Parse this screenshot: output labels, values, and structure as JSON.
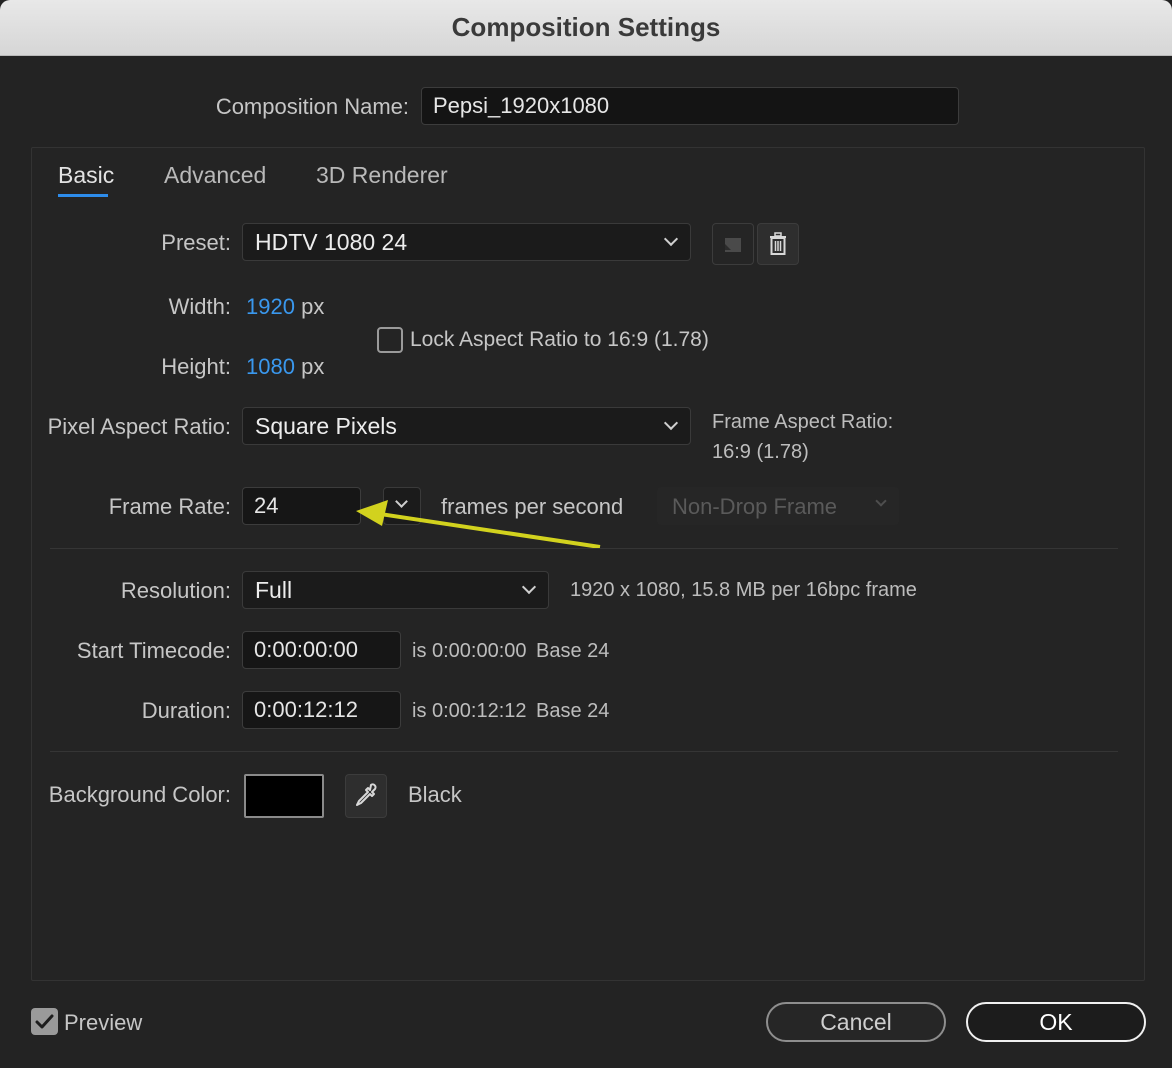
{
  "window": {
    "title": "Composition Settings"
  },
  "composition_name": {
    "label": "Composition Name:",
    "value": "Pepsi_1920x1080"
  },
  "tabs": [
    {
      "label": "Basic",
      "active": true
    },
    {
      "label": "Advanced",
      "active": false
    },
    {
      "label": "3D Renderer",
      "active": false
    }
  ],
  "preset": {
    "label": "Preset:",
    "value": "HDTV 1080 24",
    "save_icon": "save-preset-icon",
    "delete_icon": "trash-icon"
  },
  "width": {
    "label": "Width:",
    "value": "1920",
    "unit": "px"
  },
  "height": {
    "label": "Height:",
    "value": "1080",
    "unit": "px"
  },
  "lock_aspect": {
    "label": "Lock Aspect Ratio to 16:9 (1.78)",
    "checked": false
  },
  "pixel_aspect": {
    "label": "Pixel Aspect Ratio:",
    "value": "Square Pixels"
  },
  "frame_aspect": {
    "label": "Frame Aspect Ratio:",
    "value": "16:9 (1.78)"
  },
  "frame_rate": {
    "label": "Frame Rate:",
    "value": "24",
    "unit": "frames per second",
    "drop_frame": "Non-Drop Frame"
  },
  "resolution": {
    "label": "Resolution:",
    "value": "Full",
    "info": "1920 x 1080, 15.8 MB per 16bpc frame"
  },
  "start_timecode": {
    "label": "Start Timecode:",
    "value": "0:00:00:00",
    "is_text": "is 0:00:00:00",
    "base": "Base 24"
  },
  "duration": {
    "label": "Duration:",
    "value": "0:00:12:12",
    "is_text": "is 0:00:12:12",
    "base": "Base 24"
  },
  "background": {
    "label": "Background Color:",
    "color": "#000000",
    "name": "Black",
    "eyedropper_icon": "eyedropper-icon"
  },
  "preview": {
    "label": "Preview",
    "checked": true
  },
  "buttons": {
    "cancel": "Cancel",
    "ok": "OK"
  },
  "colors": {
    "accent": "#2d8ceb",
    "annotation_arrow": "#d2d21e",
    "dialog_bg": "#232323"
  }
}
